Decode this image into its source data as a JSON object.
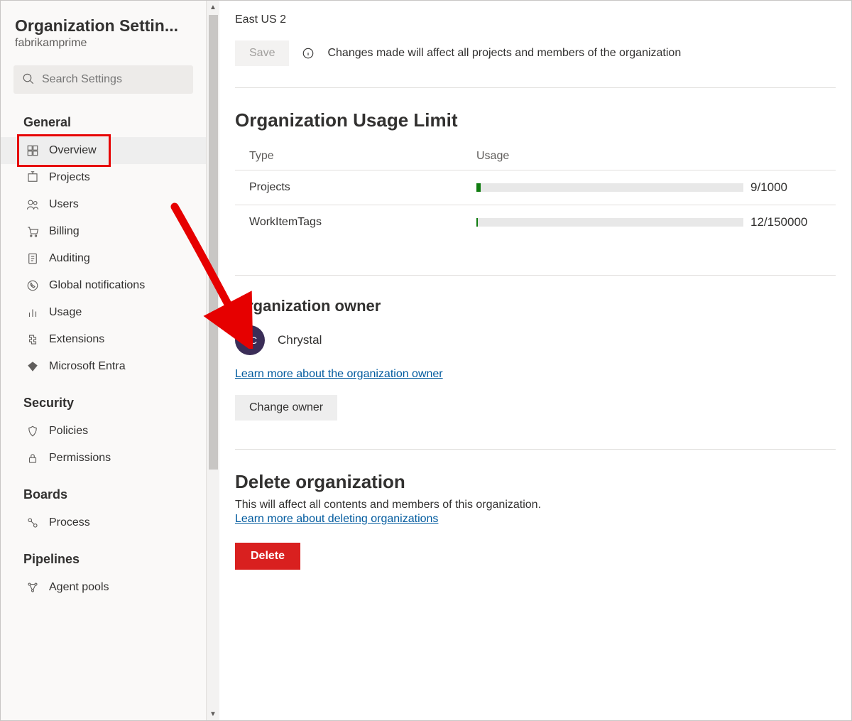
{
  "sidebar": {
    "title": "Organization Settin...",
    "subtitle": "fabrikamprime",
    "search_placeholder": "Search Settings",
    "sections": {
      "general": {
        "label": "General"
      },
      "security": {
        "label": "Security"
      },
      "boards": {
        "label": "Boards"
      },
      "pipelines": {
        "label": "Pipelines"
      }
    },
    "items": {
      "overview": "Overview",
      "projects": "Projects",
      "users": "Users",
      "billing": "Billing",
      "auditing": "Auditing",
      "global_notifications": "Global notifications",
      "usage": "Usage",
      "extensions": "Extensions",
      "entra": "Microsoft Entra",
      "policies": "Policies",
      "permissions": "Permissions",
      "process": "Process",
      "agent_pools": "Agent pools"
    }
  },
  "main": {
    "region": "East US 2",
    "save_label": "Save",
    "save_hint": "Changes made will affect all projects and members of the organization",
    "usage": {
      "title": "Organization Usage Limit",
      "col_type": "Type",
      "col_usage": "Usage",
      "rows": [
        {
          "type": "Projects",
          "used": 9,
          "limit": 1000,
          "display": "9/1000"
        },
        {
          "type": "WorkItemTags",
          "used": 12,
          "limit": 150000,
          "display": "12/150000"
        }
      ]
    },
    "owner": {
      "title": "Organization owner",
      "avatar_initials": "CC",
      "name": "Chrystal",
      "learn_more": "Learn more about the organization owner",
      "change_btn": "Change owner"
    },
    "delete": {
      "title": "Delete organization",
      "desc": "This will affect all contents and members of this organization.",
      "learn_more": "Learn more about deleting organizations",
      "btn": "Delete"
    }
  },
  "colors": {
    "annotation_red": "#e60000",
    "progress_green": "#107c10",
    "danger_red": "#d9201f",
    "link_blue": "#005a9e",
    "avatar_purple": "#3b2e58"
  }
}
